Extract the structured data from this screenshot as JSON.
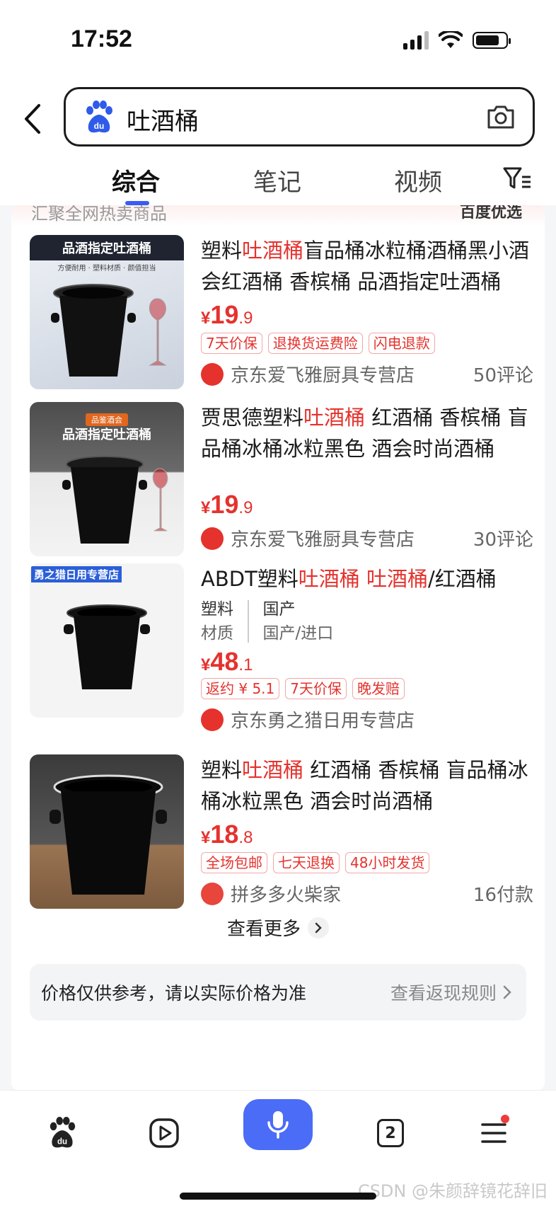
{
  "status_bar": {
    "time": "17:52"
  },
  "search": {
    "query": "吐酒桶"
  },
  "tabs": [
    {
      "label": "综合",
      "active": true
    },
    {
      "label": "笔记",
      "active": false
    },
    {
      "label": "视频",
      "active": false
    }
  ],
  "section": {
    "subtitle": "汇聚全网热卖商品",
    "brand": "百度优选"
  },
  "products": [
    {
      "title_pre": "塑料",
      "title_hl": "吐酒桶",
      "title_post": "盲品桶冰粒桶酒桶黑小酒会红酒桶 香槟桶 品酒指定吐酒桶",
      "thumb_caption": "品酒指定吐酒桶",
      "thumb_sub": "方便耐用 · 塑料材质 · 颜值担当",
      "price_currency": "¥",
      "price_int": "19",
      "price_dec": ".9",
      "tags": [
        "7天价保",
        "退换货运费险",
        "闪电退款"
      ],
      "shop": "京东爱飞雅厨具专营店",
      "meta": "50评论"
    },
    {
      "title_pre": "贾思德塑料",
      "title_hl": "吐酒桶",
      "title_post": " 红酒桶 香槟桶 盲品桶冰桶冰粒黑色 酒会时尚酒桶",
      "thumb_badge": "品鉴酒会",
      "thumb_caption": "品酒指定吐酒桶",
      "price_currency": "¥",
      "price_int": "19",
      "price_dec": ".9",
      "shop": "京东爱飞雅厨具专营店",
      "meta": "30评论"
    },
    {
      "title_pre": "ABDT塑料",
      "title_hl": "吐酒桶 吐酒桶",
      "title_post": "/红酒桶",
      "thumb_caption": "勇之猎日用专营店",
      "attrs": [
        {
          "value": "塑料",
          "name": "材质"
        },
        {
          "value": "国产",
          "name": "国产/进口"
        }
      ],
      "price_currency": "¥",
      "price_int": "48",
      "price_dec": ".1",
      "tags": [
        "返约 ¥ 5.1",
        "7天价保",
        "晚发赔"
      ],
      "shop": "京东勇之猎日用专营店"
    },
    {
      "title_pre": "塑料",
      "title_hl": "吐酒桶",
      "title_post": " 红酒桶 香槟桶 盲品桶冰桶冰粒黑色 酒会时尚酒桶",
      "price_currency": "¥",
      "price_int": "18",
      "price_dec": ".8",
      "tags": [
        "全场包邮",
        "七天退换",
        "48小时发货"
      ],
      "shop": "拼多多火柴家",
      "meta": "16付款"
    }
  ],
  "more": {
    "label": "查看更多"
  },
  "notice": {
    "text": "价格仅供参考，请以实际价格为准",
    "link": "查看返现规则"
  },
  "bottom_nav": {
    "tab_count": "2"
  },
  "watermark": "CSDN @朱颜辞镜花辞旧",
  "colors": {
    "accent": "#3a5cf5",
    "price": "#e5322d",
    "mic": "#4a6cf7"
  }
}
